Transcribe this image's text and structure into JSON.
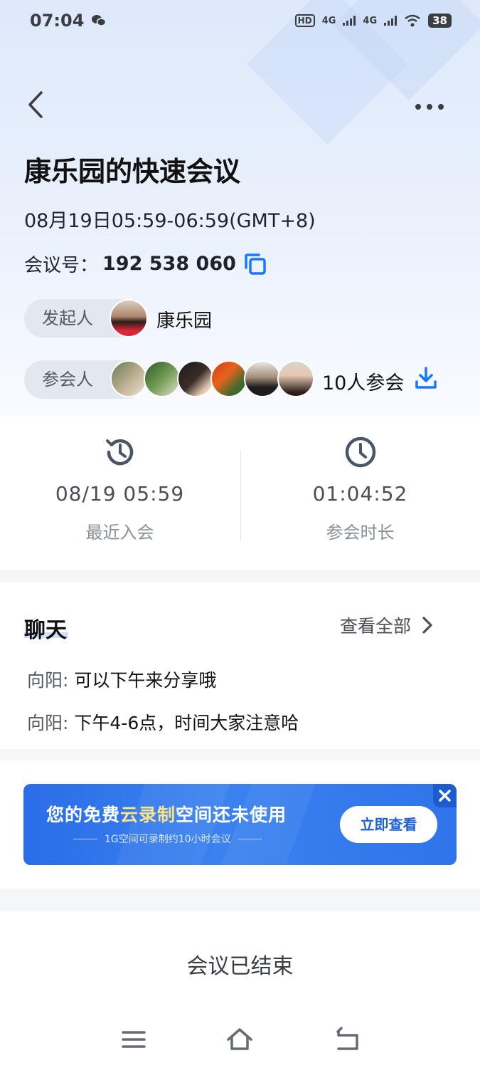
{
  "status_bar": {
    "time": "07:04",
    "hd_label": "HD",
    "net1": "4G",
    "net2": "4G",
    "battery": "38"
  },
  "meeting": {
    "title": "康乐园的快速会议",
    "time_range": "08月19日05:59-06:59(GMT+8)",
    "id_label": "会议号：",
    "id_value": "192 538 060",
    "host_label": "发起人",
    "host_name": "康乐园",
    "attendees_label": "参会人",
    "attendee_count": "10人参会"
  },
  "stats": {
    "last_join_value": "08/19 05:59",
    "last_join_label": "最近入会",
    "duration_value": "01:04:52",
    "duration_label": "参会时长"
  },
  "chat": {
    "title": "聊天",
    "view_all": "查看全部",
    "messages": [
      {
        "sender": "向阳:",
        "text": "可以下午来分享哦"
      },
      {
        "sender": "向阳:",
        "text": "下午4-6点，时间大家注意哈"
      }
    ]
  },
  "banner": {
    "title_part1": "您的免费",
    "title_highlight": "云录制",
    "title_part2": "空间还未使用",
    "subtitle": "1G空间可录制约10小时会议",
    "button": "立即查看"
  },
  "footer": {
    "status": "会议已结束"
  },
  "colors": {
    "accent": "#1677ff",
    "banner_blue": "#2f74ea",
    "highlight": "#fbe38a"
  }
}
